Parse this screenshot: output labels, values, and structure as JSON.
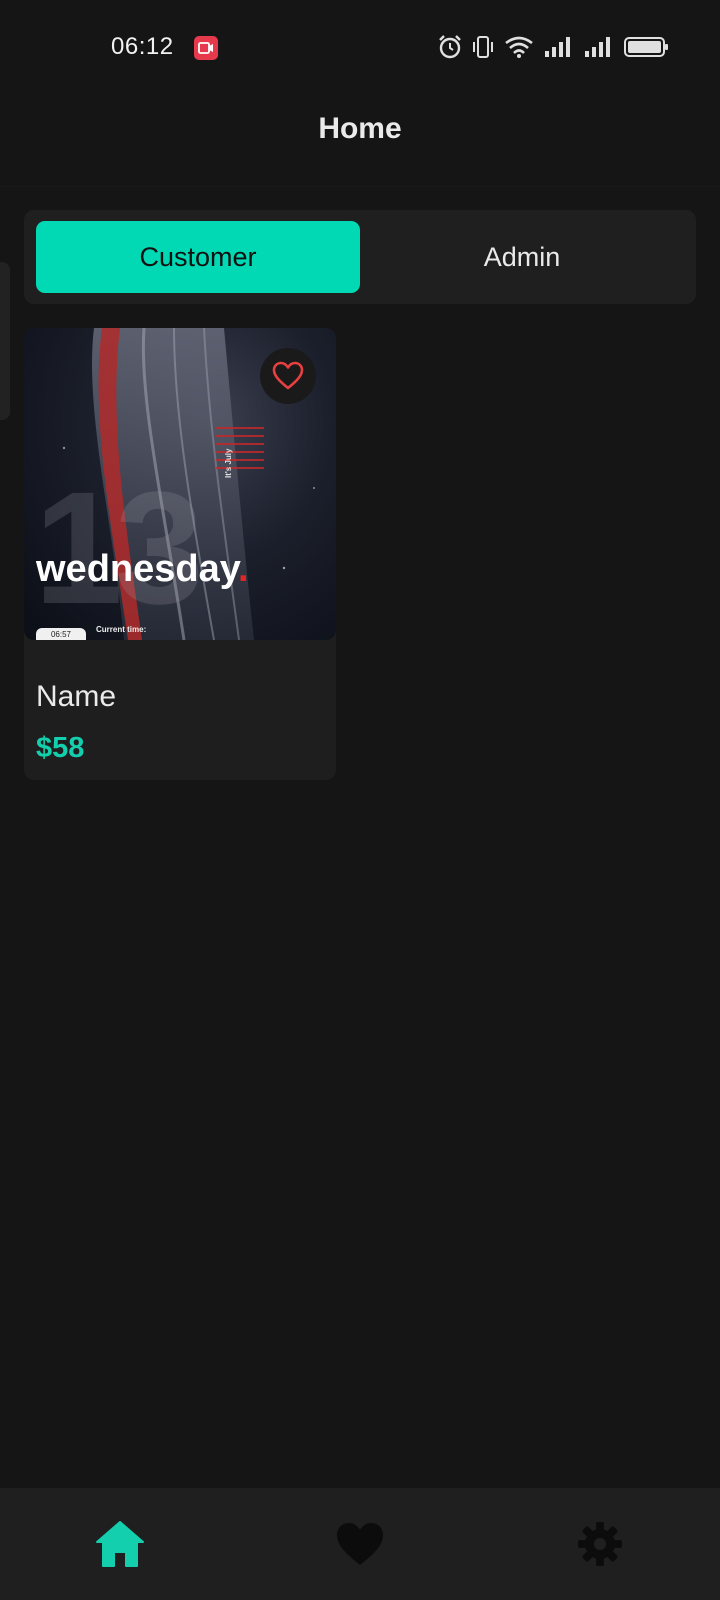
{
  "status_bar": {
    "time": "06:12",
    "icons": [
      "screen-record-icon",
      "alarm-icon",
      "vibrate-icon",
      "wifi-icon",
      "signal-icon",
      "signal-icon",
      "battery-icon"
    ]
  },
  "header": {
    "title": "Home"
  },
  "tabs": [
    {
      "label": "Customer",
      "selected": true
    },
    {
      "label": "Admin",
      "selected": false
    }
  ],
  "products": [
    {
      "name": "Name",
      "price": "$58",
      "favorite": false,
      "image": {
        "number": "13",
        "day": "wednesday",
        "day_suffix": ".",
        "month": "It's July",
        "pill": "06:57",
        "caption": "Current time:"
      }
    }
  ],
  "bottom_nav": {
    "items": [
      {
        "icon": "home-icon",
        "active": true
      },
      {
        "icon": "heart-icon",
        "active": false
      },
      {
        "icon": "settings-icon",
        "active": false
      }
    ]
  },
  "colors": {
    "background": "#151515",
    "surface": "#1f1f1f",
    "accent": "#00d9b4",
    "favorite": "#e84040"
  }
}
